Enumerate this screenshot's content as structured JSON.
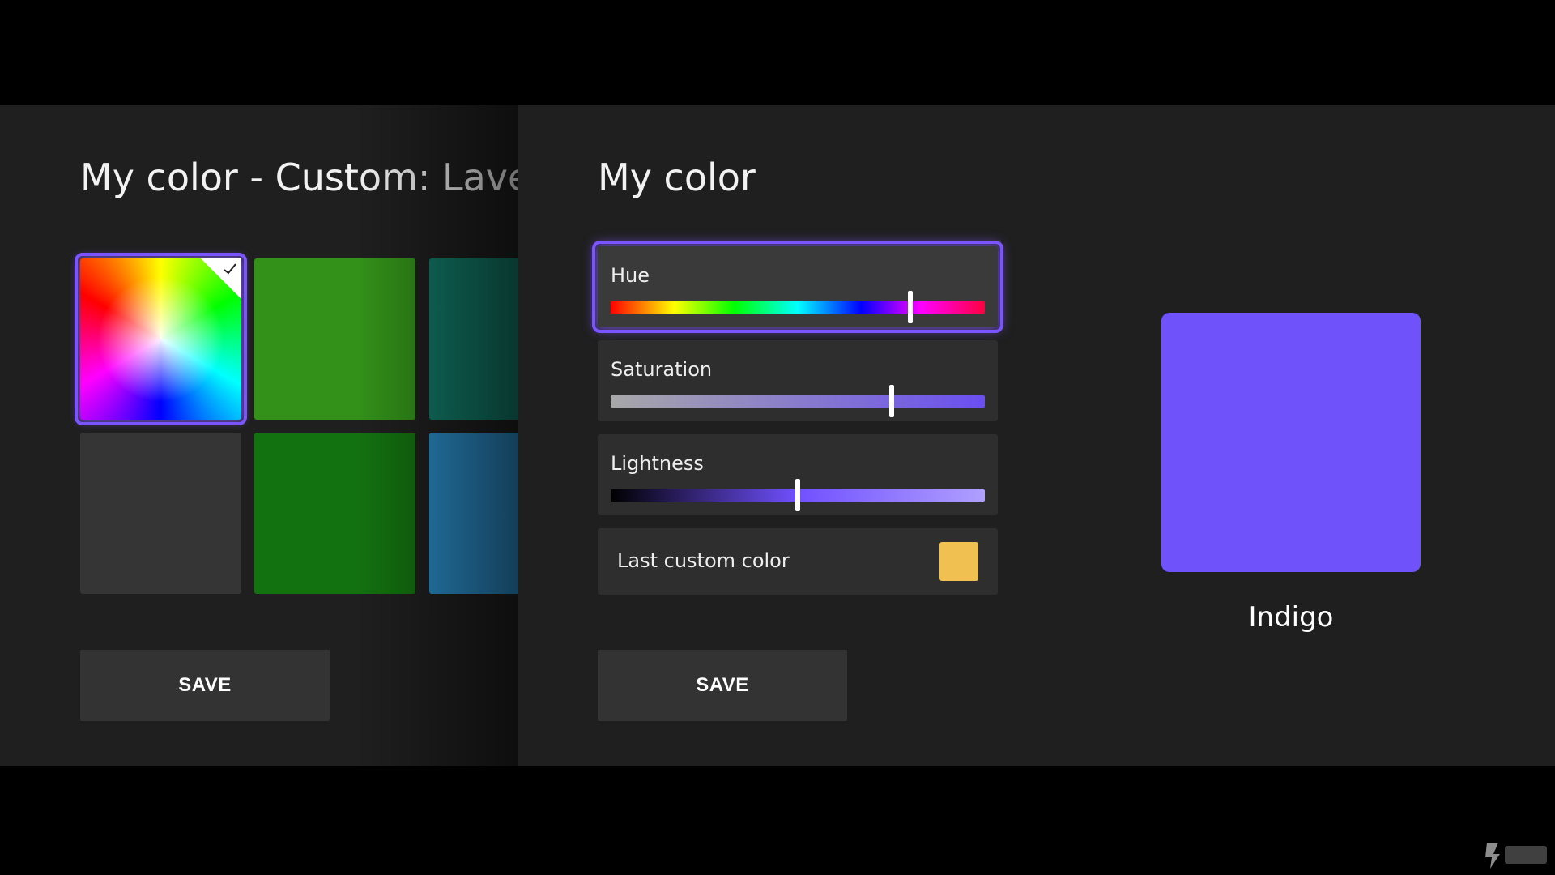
{
  "left_panel": {
    "title": "My color - Custom: Laven",
    "swatches": [
      {
        "color": "rainbow",
        "selected": true,
        "icon": "check-icon"
      },
      {
        "color": "#339119"
      },
      {
        "color": "#127967"
      },
      {
        "color": "#353535"
      },
      {
        "color": "#137210"
      },
      {
        "color": "#2a8ac4"
      }
    ],
    "save_label": "SAVE"
  },
  "right_panel": {
    "title": "My color",
    "hue": {
      "label": "Hue",
      "value": 0.8
    },
    "saturation": {
      "label": "Saturation",
      "value": 0.75
    },
    "lightness": {
      "label": "Lightness",
      "value": 0.5
    },
    "last_custom": {
      "label": "Last custom color",
      "color": "#f0c050"
    },
    "save_label": "SAVE",
    "preview": {
      "color": "#6f52f9",
      "name": "Indigo"
    }
  },
  "colors": {
    "accent": "#7a55ff",
    "panel_bg": "#1f1f1f",
    "card_bg": "#2e2e2e"
  }
}
